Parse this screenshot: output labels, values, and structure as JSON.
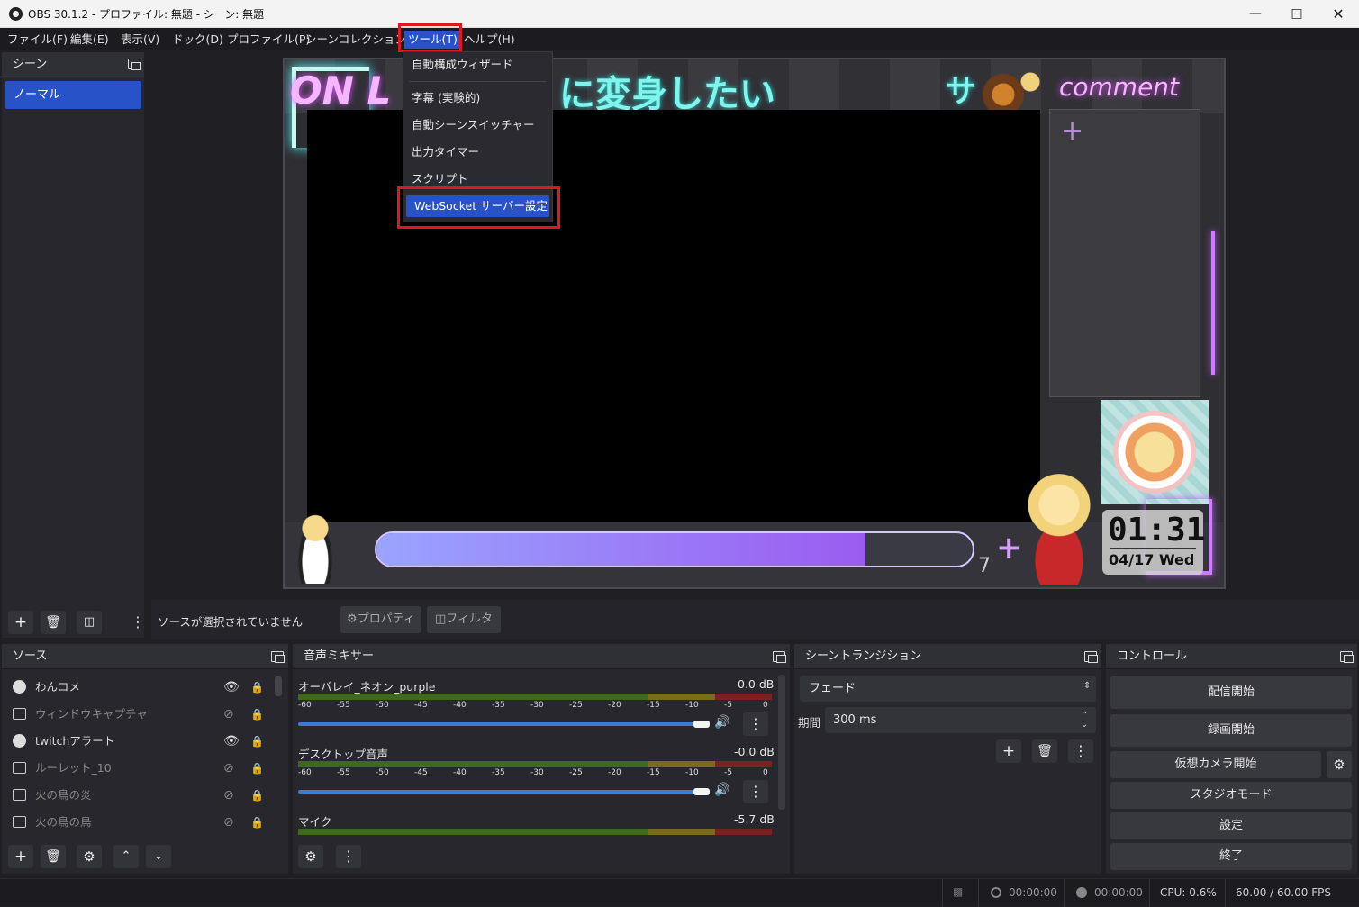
{
  "window": {
    "title": "OBS 30.1.2 - プロファイル: 無題 - シーン: 無題"
  },
  "menubar": [
    {
      "label": "ファイル(F)"
    },
    {
      "label": "編集(E)"
    },
    {
      "label": "表示(V)"
    },
    {
      "label": "ドック(D)"
    },
    {
      "label": "プロファイル(P)"
    },
    {
      "label": "シーンコレクション(S)"
    },
    {
      "label": "ツール(T)",
      "active": true
    },
    {
      "label": "ヘルプ(H)"
    }
  ],
  "tools_menu": [
    {
      "label": "自動構成ウィザード"
    },
    {
      "label": "字幕 (実験的)"
    },
    {
      "label": "自動シーンスイッチャー"
    },
    {
      "label": "出力タイマー"
    },
    {
      "label": "スクリプト"
    },
    {
      "label": "WebSocket サーバー設定",
      "highlighted": true
    }
  ],
  "scenes": {
    "title": "シーン",
    "items": [
      "ノーマル"
    ]
  },
  "preview": {
    "overlay_text_left": "ON L",
    "overlay_text_title": "に変身したい",
    "overlay_text_right": "comment",
    "overlay_letter": "サ",
    "clock_time": "01:31",
    "clock_date": "04/17 Wed",
    "progress_fraction": 0.82,
    "corner_number": "7"
  },
  "source_bar": {
    "no_selection": "ソースが選択されていません",
    "properties": "プロパティ",
    "filters": "フィルタ"
  },
  "sources": {
    "title": "ソース",
    "items": [
      {
        "name": "わんコメ",
        "visible": true,
        "type": "browser"
      },
      {
        "name": "ウィンドウキャプチャ",
        "visible": false,
        "type": "window"
      },
      {
        "name": "twitchアラート",
        "visible": true,
        "type": "browser"
      },
      {
        "name": "ルーレット_10",
        "visible": false,
        "type": "window"
      },
      {
        "name": "火の鳥の炎",
        "visible": false,
        "type": "image"
      },
      {
        "name": "火の鳥の鳥",
        "visible": false,
        "type": "image"
      }
    ]
  },
  "mixer": {
    "title": "音声ミキサー",
    "scale": [
      "-60",
      "-55",
      "-50",
      "-45",
      "-40",
      "-35",
      "-30",
      "-25",
      "-20",
      "-15",
      "-10",
      "-5",
      "0"
    ],
    "channels": [
      {
        "name": "オーバレイ_ネオン_purple",
        "db": "0.0 dB"
      },
      {
        "name": "デスクトップ音声",
        "db": "-0.0 dB"
      },
      {
        "name": "マイク",
        "db": "-5.7 dB"
      }
    ]
  },
  "transitions": {
    "title": "シーントランジション",
    "type": "フェード",
    "duration_label": "期間",
    "duration": "300 ms"
  },
  "controls": {
    "title": "コントロール",
    "buttons": [
      "配信開始",
      "録画開始",
      "仮想カメラ開始",
      "スタジオモード",
      "設定",
      "終了"
    ]
  },
  "statusbar": {
    "stream_time": "00:00:00",
    "rec_time": "00:00:00",
    "cpu": "CPU: 0.6%",
    "fps": "60.00 / 60.00 FPS"
  },
  "colors": {
    "accent": "#2852c8",
    "highlight_box": "#e0181e"
  }
}
